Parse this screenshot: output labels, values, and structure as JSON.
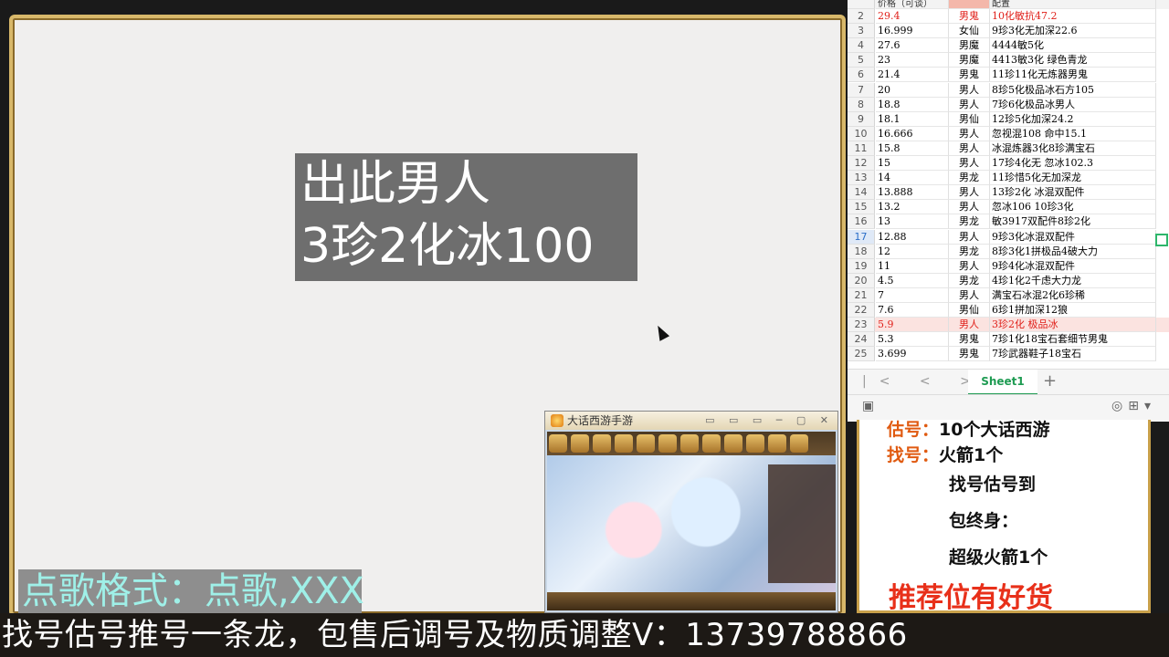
{
  "notice": {
    "line1": "出此男人",
    "line2": "3珍2化冰100"
  },
  "song_format": "点歌格式：点歌,XXX",
  "game_window": {
    "title": "大话西游手游",
    "controls": "▭ ▭ ▭ ─ ▢ ✕"
  },
  "spreadsheet": {
    "headers": {
      "price": "价格（可谈）",
      "role": "",
      "config": "配置"
    },
    "rows": [
      {
        "n": "2",
        "price": "29.4",
        "role": "男鬼",
        "config": "10化敏抗47.2",
        "style": "red"
      },
      {
        "n": "3",
        "price": "16.999",
        "role": "女仙",
        "config": "9珍3化无加深22.6",
        "style": ""
      },
      {
        "n": "4",
        "price": "27.6",
        "role": "男魔",
        "config": "4444敏5化",
        "style": ""
      },
      {
        "n": "5",
        "price": "23",
        "role": "男魔",
        "config": "4413敏3化 绿色青龙",
        "style": ""
      },
      {
        "n": "6",
        "price": "21.4",
        "role": "男鬼",
        "config": "11珍11化无炼器男鬼",
        "style": ""
      },
      {
        "n": "7",
        "price": "20",
        "role": "男人",
        "config": "8珍5化极品冰石方105",
        "style": ""
      },
      {
        "n": "8",
        "price": "18.8",
        "role": "男人",
        "config": "7珍6化极品冰男人",
        "style": ""
      },
      {
        "n": "9",
        "price": "18.1",
        "role": "男仙",
        "config": "12珍5化加深24.2",
        "style": ""
      },
      {
        "n": "10",
        "price": "16.666",
        "role": "男人",
        "config": "忽视混108 命中15.1",
        "style": ""
      },
      {
        "n": "11",
        "price": "15.8",
        "role": "男人",
        "config": "冰混炼器3化8珍满宝石",
        "style": ""
      },
      {
        "n": "12",
        "price": "15",
        "role": "男人",
        "config": "17珍4化无 忽冰102.3",
        "style": ""
      },
      {
        "n": "13",
        "price": "14",
        "role": "男龙",
        "config": "11珍惜5化无加深龙",
        "style": ""
      },
      {
        "n": "14",
        "price": "13.888",
        "role": "男人",
        "config": "13珍2化 冰混双配件",
        "style": ""
      },
      {
        "n": "15",
        "price": "13.2",
        "role": "男人",
        "config": "忽冰106 10珍3化",
        "style": ""
      },
      {
        "n": "16",
        "price": "13",
        "role": "男龙",
        "config": "敏3917双配件8珍2化",
        "style": ""
      },
      {
        "n": "17",
        "price": "12.88",
        "role": "男人",
        "config": "9珍3化冰混双配件",
        "style": "sel"
      },
      {
        "n": "18",
        "price": "12",
        "role": "男龙",
        "config": "8珍3化1拼极品4破大力",
        "style": ""
      },
      {
        "n": "19",
        "price": "11",
        "role": "男人",
        "config": "9珍4化冰混双配件",
        "style": ""
      },
      {
        "n": "20",
        "price": "4.5",
        "role": "男龙",
        "config": "4珍1化2千虑大力龙",
        "style": ""
      },
      {
        "n": "21",
        "price": "7",
        "role": "男人",
        "config": "满宝石冰混2化6珍稀",
        "style": ""
      },
      {
        "n": "22",
        "price": "7.6",
        "role": "男仙",
        "config": "6珍1拼加深12狼",
        "style": ""
      },
      {
        "n": "23",
        "price": "5.9",
        "role": "男人",
        "config": "3珍2化 极品冰",
        "style": "red hl"
      },
      {
        "n": "24",
        "price": "5.3",
        "role": "男鬼",
        "config": "7珍1化18宝石套细节男鬼",
        "style": ""
      },
      {
        "n": "25",
        "price": "3.699",
        "role": "男鬼",
        "config": "7珍武器鞋子18宝石",
        "style": ""
      }
    ],
    "tab_label": "Sheet1",
    "add_tab": "+",
    "nav_arrows": "|< < > >|"
  },
  "ad": {
    "line1_label": "估号：",
    "line1_text": "10个大话西游",
    "line2_label": "找号：",
    "line2_text": "火箭1个",
    "line3": "找号估号到",
    "line4": "包终身：",
    "line5": "超级火箭1个",
    "line6": "推荐位有好货"
  },
  "ticker": "找号估号推号一条龙，包售后调号及物质调整V：13739788866",
  "colors": {
    "frame_gold": "#d8b86a",
    "notice_bg": "#6e6e6e",
    "song_text": "#9ff0e8",
    "accent_orange": "#e05a10",
    "sheet_red": "#e0201a",
    "sheet_green": "#1e9b52"
  }
}
